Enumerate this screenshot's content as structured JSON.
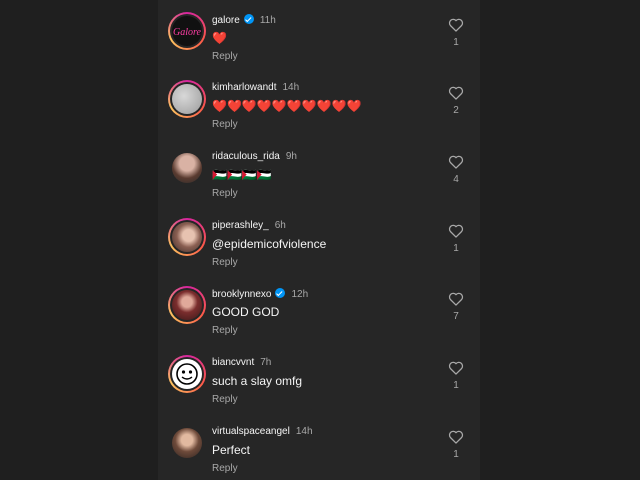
{
  "reply_label": "Reply",
  "comments": [
    {
      "username": "galore",
      "verified": true,
      "time": "11h",
      "text": "❤️",
      "likes": "1",
      "avatar_icon": "galore-logo"
    },
    {
      "username": "kimharlowandt",
      "verified": false,
      "time": "14h",
      "text": "❤️❤️❤️❤️❤️❤️❤️❤️❤️❤️",
      "likes": "2",
      "avatar_icon": "grey-circle"
    },
    {
      "username": "ridaculous_rida",
      "verified": false,
      "time": "9h",
      "text": "🇵🇸🇵🇸🇵🇸🇵🇸",
      "likes": "4",
      "avatar_icon": "photo"
    },
    {
      "username": "piperashley_",
      "verified": false,
      "time": "6h",
      "text": "@epidemicofviolence",
      "likes": "1",
      "avatar_icon": "photo"
    },
    {
      "username": "brooklynnexo",
      "verified": true,
      "time": "12h",
      "text": "GOOD GOD",
      "likes": "7",
      "avatar_icon": "photo"
    },
    {
      "username": "biancvvnt",
      "verified": false,
      "time": "7h",
      "text": "such a slay omfg",
      "likes": "1",
      "avatar_icon": "cartoon"
    },
    {
      "username": "virtualspaceangel",
      "verified": false,
      "time": "14h",
      "text": "Perfect",
      "likes": "1",
      "avatar_icon": "photo"
    }
  ],
  "colors": {
    "background": "#262626",
    "text": "#f5f5f5",
    "muted": "#a8a8a8",
    "verified": "#0095f6",
    "heart": "#ed1c24"
  }
}
